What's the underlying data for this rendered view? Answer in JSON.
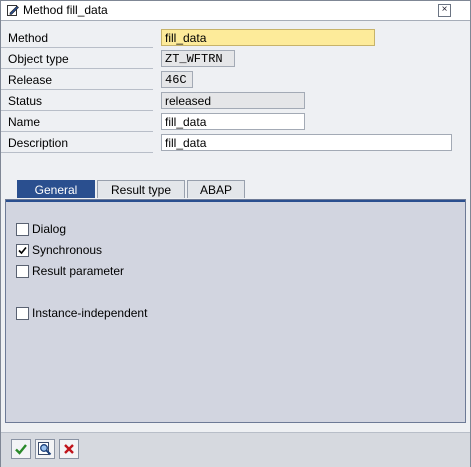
{
  "window": {
    "title": "Method fill_data",
    "close_glyph": "×"
  },
  "form": {
    "fields": [
      {
        "label": "Method",
        "value": "fill_data"
      },
      {
        "label": "Object type",
        "value": "ZT_WFTRN"
      },
      {
        "label": "Release",
        "value": "46C"
      },
      {
        "label": "Status",
        "value": "released"
      },
      {
        "label": "Name",
        "value": "fill_data"
      },
      {
        "label": "Description",
        "value": "fill_data"
      }
    ]
  },
  "tabs": [
    {
      "label": "General",
      "active": true
    },
    {
      "label": "Result type",
      "active": false
    },
    {
      "label": "ABAP",
      "active": false
    }
  ],
  "general": {
    "options": [
      {
        "label": "Dialog",
        "checked": false
      },
      {
        "label": "Synchronous",
        "checked": true
      },
      {
        "label": "Result parameter",
        "checked": false
      },
      {
        "label": "Instance-independent",
        "checked": false
      }
    ]
  },
  "footer": {
    "buttons": [
      "continue",
      "where-used",
      "cancel"
    ]
  },
  "colors": {
    "accent": "#2a4f8f",
    "focus_field": "#fdeb9a",
    "panel": "#d2d5e0",
    "ok_green": "#2a8a2a",
    "cancel_red": "#c0141b"
  }
}
